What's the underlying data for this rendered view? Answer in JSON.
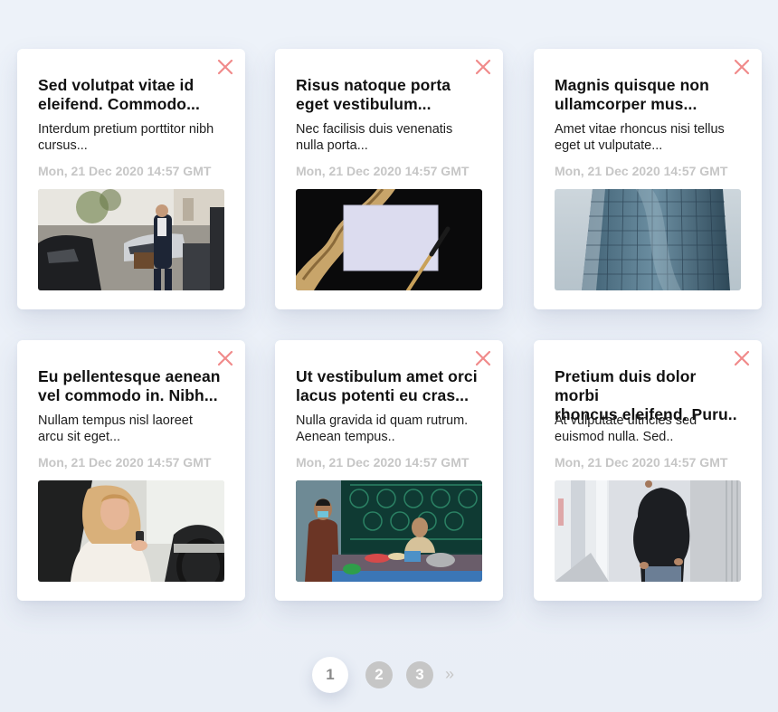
{
  "colors": {
    "close": "#f08a8a",
    "date": "#c6c6c6",
    "page_inactive": "#c6c6c6"
  },
  "cards": [
    {
      "title": "Sed volutpat vitae id\neleifend. Commodo...",
      "description": "Interdum pretium porttitor nibh\ncursus...",
      "date": "Mon, 21 Dec 2020 14:57 GMT",
      "image": "street-businessmen-photo",
      "close_icon": "close-icon"
    },
    {
      "title": "Risus natoque porta\neget vestibulum...",
      "description": "Nec facilisis duis venenatis\nnulla porta...",
      "date": "Mon, 21 Dec 2020 14:57 GMT",
      "image": "blank-card-with-pen-photo",
      "close_icon": "close-icon"
    },
    {
      "title": "Magnis quisque non\nullamcorper mus...",
      "description": "Amet vitae rhoncus nisi tellus\neget ut vulputate...",
      "date": "Mon, 21 Dec 2020 14:57 GMT",
      "image": "glass-skyscraper-photo",
      "close_icon": "close-icon"
    },
    {
      "title": "Eu pellentesque aenean\nvel commodo in. Nibh...",
      "description": "Nullam tempus nisl laoreet\narcu sit eget...",
      "date": "Mon, 21 Dec 2020 14:57 GMT",
      "image": "woman-in-car-with-phone-photo",
      "close_icon": "close-icon"
    },
    {
      "title": "Ut vestibulum amet orci\nlacus potenti eu cras...",
      "description": "Nulla gravida id quam rutrum.\nAenean tempus..",
      "date": "Mon, 21 Dec 2020 14:57 GMT",
      "image": "market-vendors-photo",
      "close_icon": "close-icon"
    },
    {
      "title": "Pretium duis dolor morbi\nrhoncus eleifend. Puru..",
      "description": "At vulputate ultricies sed\neuismod nulla. Sed..",
      "date": "Mon, 21 Dec 2020 14:57 GMT",
      "image": "man-leaning-wall-photo",
      "close_icon": "close-icon"
    }
  ],
  "pagination": {
    "current": "1",
    "pages": [
      "2",
      "3"
    ],
    "next_label": "»"
  }
}
